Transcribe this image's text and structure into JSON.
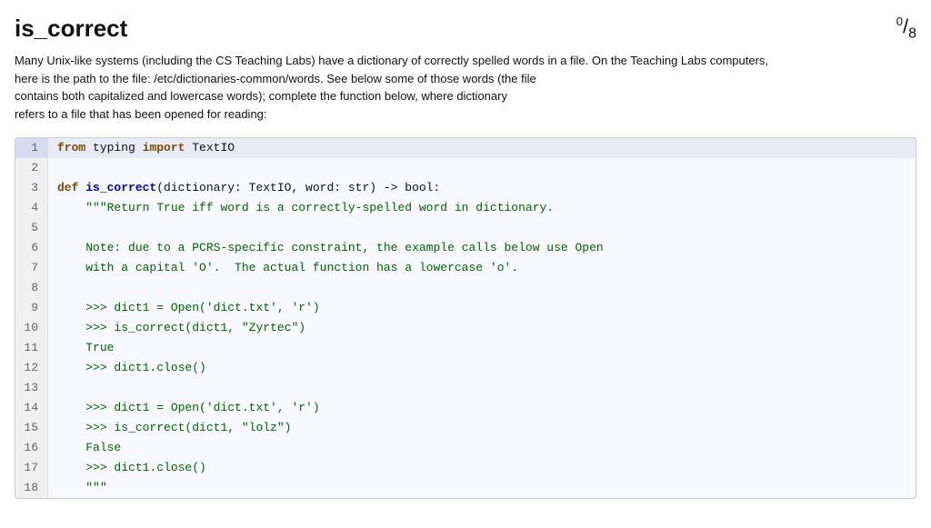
{
  "header": {
    "title": "is_correct",
    "score_numerator": "0",
    "score_denominator": "8"
  },
  "description": {
    "line1": "Many Unix-like systems (including the CS Teaching Labs) have a dictionary of correctly spelled words in a file. On the Teaching Labs computers,",
    "line2": "here is the path to the file: /etc/dictionaries-common/words. See below some of those words (the file",
    "line3": "contains both capitalized and lowercase words); complete the function below, where dictionary",
    "line4": "refers to a file that has been opened for reading:"
  },
  "code": {
    "lines": [
      {
        "num": 1,
        "highlighted": true
      },
      {
        "num": 2,
        "highlighted": false
      },
      {
        "num": 3,
        "highlighted": false
      },
      {
        "num": 4,
        "highlighted": false
      },
      {
        "num": 5,
        "highlighted": false
      },
      {
        "num": 6,
        "highlighted": false
      },
      {
        "num": 7,
        "highlighted": false
      },
      {
        "num": 8,
        "highlighted": false
      },
      {
        "num": 9,
        "highlighted": false
      },
      {
        "num": 10,
        "highlighted": false
      },
      {
        "num": 11,
        "highlighted": false
      },
      {
        "num": 12,
        "highlighted": false
      },
      {
        "num": 13,
        "highlighted": false
      },
      {
        "num": 14,
        "highlighted": false
      },
      {
        "num": 15,
        "highlighted": false
      },
      {
        "num": 16,
        "highlighted": false
      },
      {
        "num": 17,
        "highlighted": false
      },
      {
        "num": 18,
        "highlighted": false
      }
    ]
  }
}
